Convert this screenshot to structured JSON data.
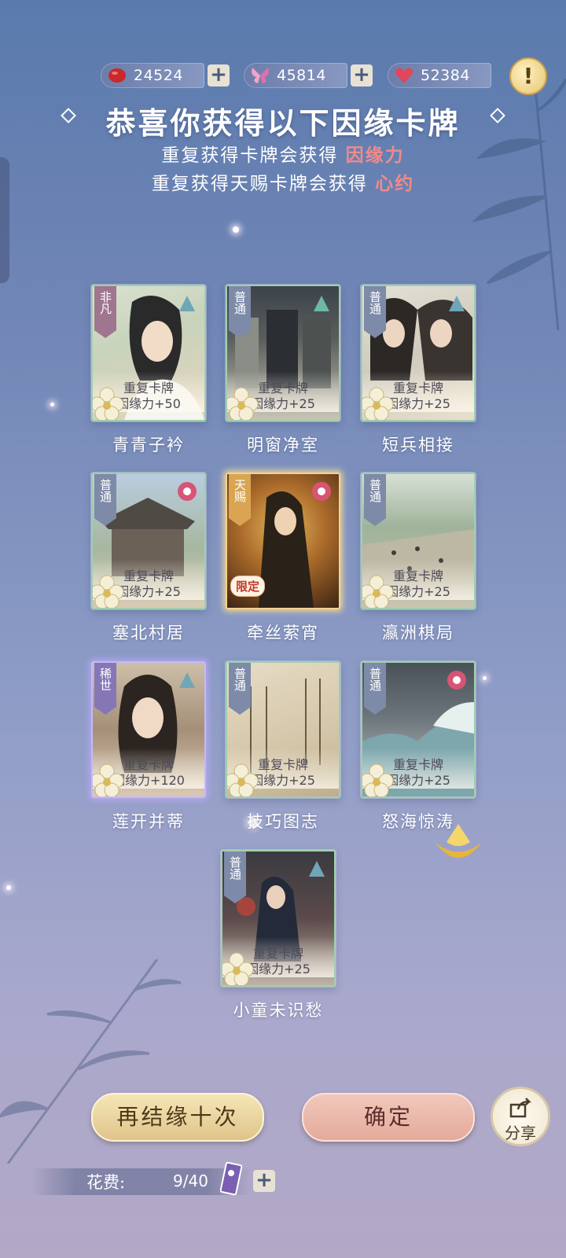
{
  "currencies": [
    {
      "icon": "red-bean-icon",
      "value": "24524",
      "plus": "+"
    },
    {
      "icon": "butterfly-icon",
      "value": "45814",
      "plus": "+"
    },
    {
      "icon": "heart-icon",
      "value": "52384"
    }
  ],
  "alert_label": "!",
  "headline": "恭喜你获得以下因缘卡牌",
  "subtitle1": {
    "text": "重复获得卡牌会获得",
    "highlight": "因缘力"
  },
  "subtitle2": {
    "text": "重复获得天赐卡牌会获得",
    "highlight": "心约"
  },
  "cards": [
    {
      "rarity": "非凡",
      "name": "青青子衿",
      "dup_title": "重复卡牌",
      "dup_bonus": "因缘力+50",
      "style": "top"
    },
    {
      "rarity": "普通",
      "name": "明窗净室",
      "dup_title": "重复卡牌",
      "dup_bonus": "因缘力+25",
      "style": "normal"
    },
    {
      "rarity": "普通",
      "name": "短兵相接",
      "dup_title": "重复卡牌",
      "dup_bonus": "因缘力+25",
      "style": "normal"
    },
    {
      "rarity": "普通",
      "name": "塞北村居",
      "dup_title": "重复卡牌",
      "dup_bonus": "因缘力+25",
      "style": "normal"
    },
    {
      "rarity": "天赐",
      "name": "牵丝萦宵",
      "badge": "限定",
      "style": "gold"
    },
    {
      "rarity": "普通",
      "name": "瀛洲棋局",
      "dup_title": "重复卡牌",
      "dup_bonus": "因缘力+25",
      "style": "normal"
    },
    {
      "rarity": "稀世",
      "name": "莲开并蒂",
      "dup_title": "重复卡牌",
      "dup_bonus": "因缘力+120",
      "style": "purple"
    },
    {
      "rarity": "普通",
      "name": "技巧图志",
      "dup_title": "重复卡牌",
      "dup_bonus": "因缘力+25",
      "style": "normal"
    },
    {
      "rarity": "普通",
      "name": "怒海惊涛",
      "dup_title": "重复卡牌",
      "dup_bonus": "因缘力+25",
      "style": "normal"
    },
    {
      "rarity": "普通",
      "name": "小童未识愁",
      "dup_title": "重复卡牌",
      "dup_bonus": "因缘力+25",
      "style": "normal"
    }
  ],
  "buttons": {
    "again": "再结缘十次",
    "confirm": "确定",
    "share": "分享"
  },
  "cost": {
    "label": "花费:",
    "value": "9/40",
    "plus": "+"
  }
}
